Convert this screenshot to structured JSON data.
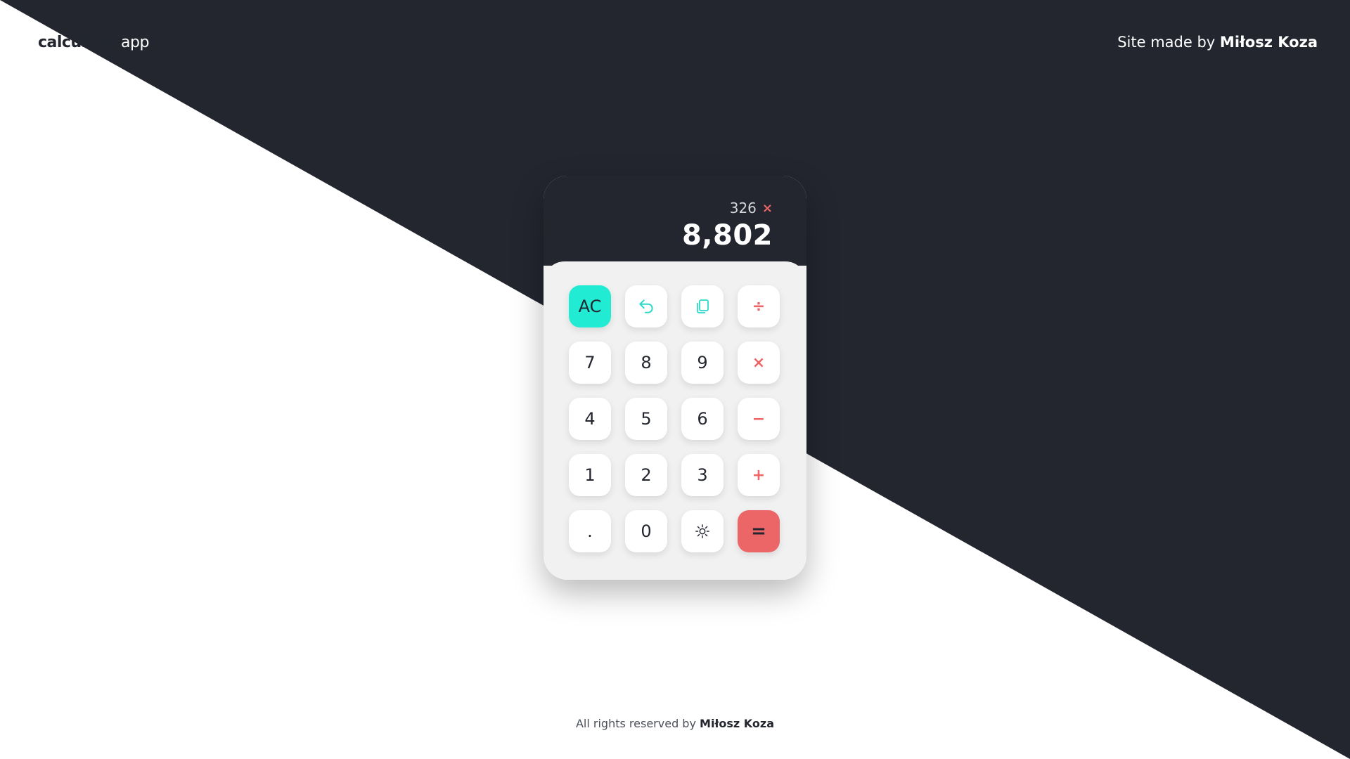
{
  "header": {
    "logo_bold": "calculator",
    "logo_light": "app",
    "credit_prefix": "Site made by",
    "credit_name": "Miłosz Koza"
  },
  "display": {
    "previous_value": "326",
    "operator_symbol": "×",
    "current_value": "8,802"
  },
  "keys": {
    "clear": "AC",
    "undo_icon": "undo-icon",
    "copy_icon": "copy-icon",
    "divide": "÷",
    "seven": "7",
    "eight": "8",
    "nine": "9",
    "multiply": "×",
    "four": "4",
    "five": "5",
    "six": "6",
    "minus": "−",
    "one": "1",
    "two": "2",
    "three": "3",
    "plus": "+",
    "dot": ".",
    "zero": "0",
    "theme_icon": "sun-icon",
    "equals": "="
  },
  "footer": {
    "prefix": "All rights reserved by",
    "name": "Miłosz Koza"
  },
  "colors": {
    "dark": "#23262f",
    "teal": "#21ebd3",
    "red": "#ec6668",
    "light": "#f1f1f1"
  }
}
